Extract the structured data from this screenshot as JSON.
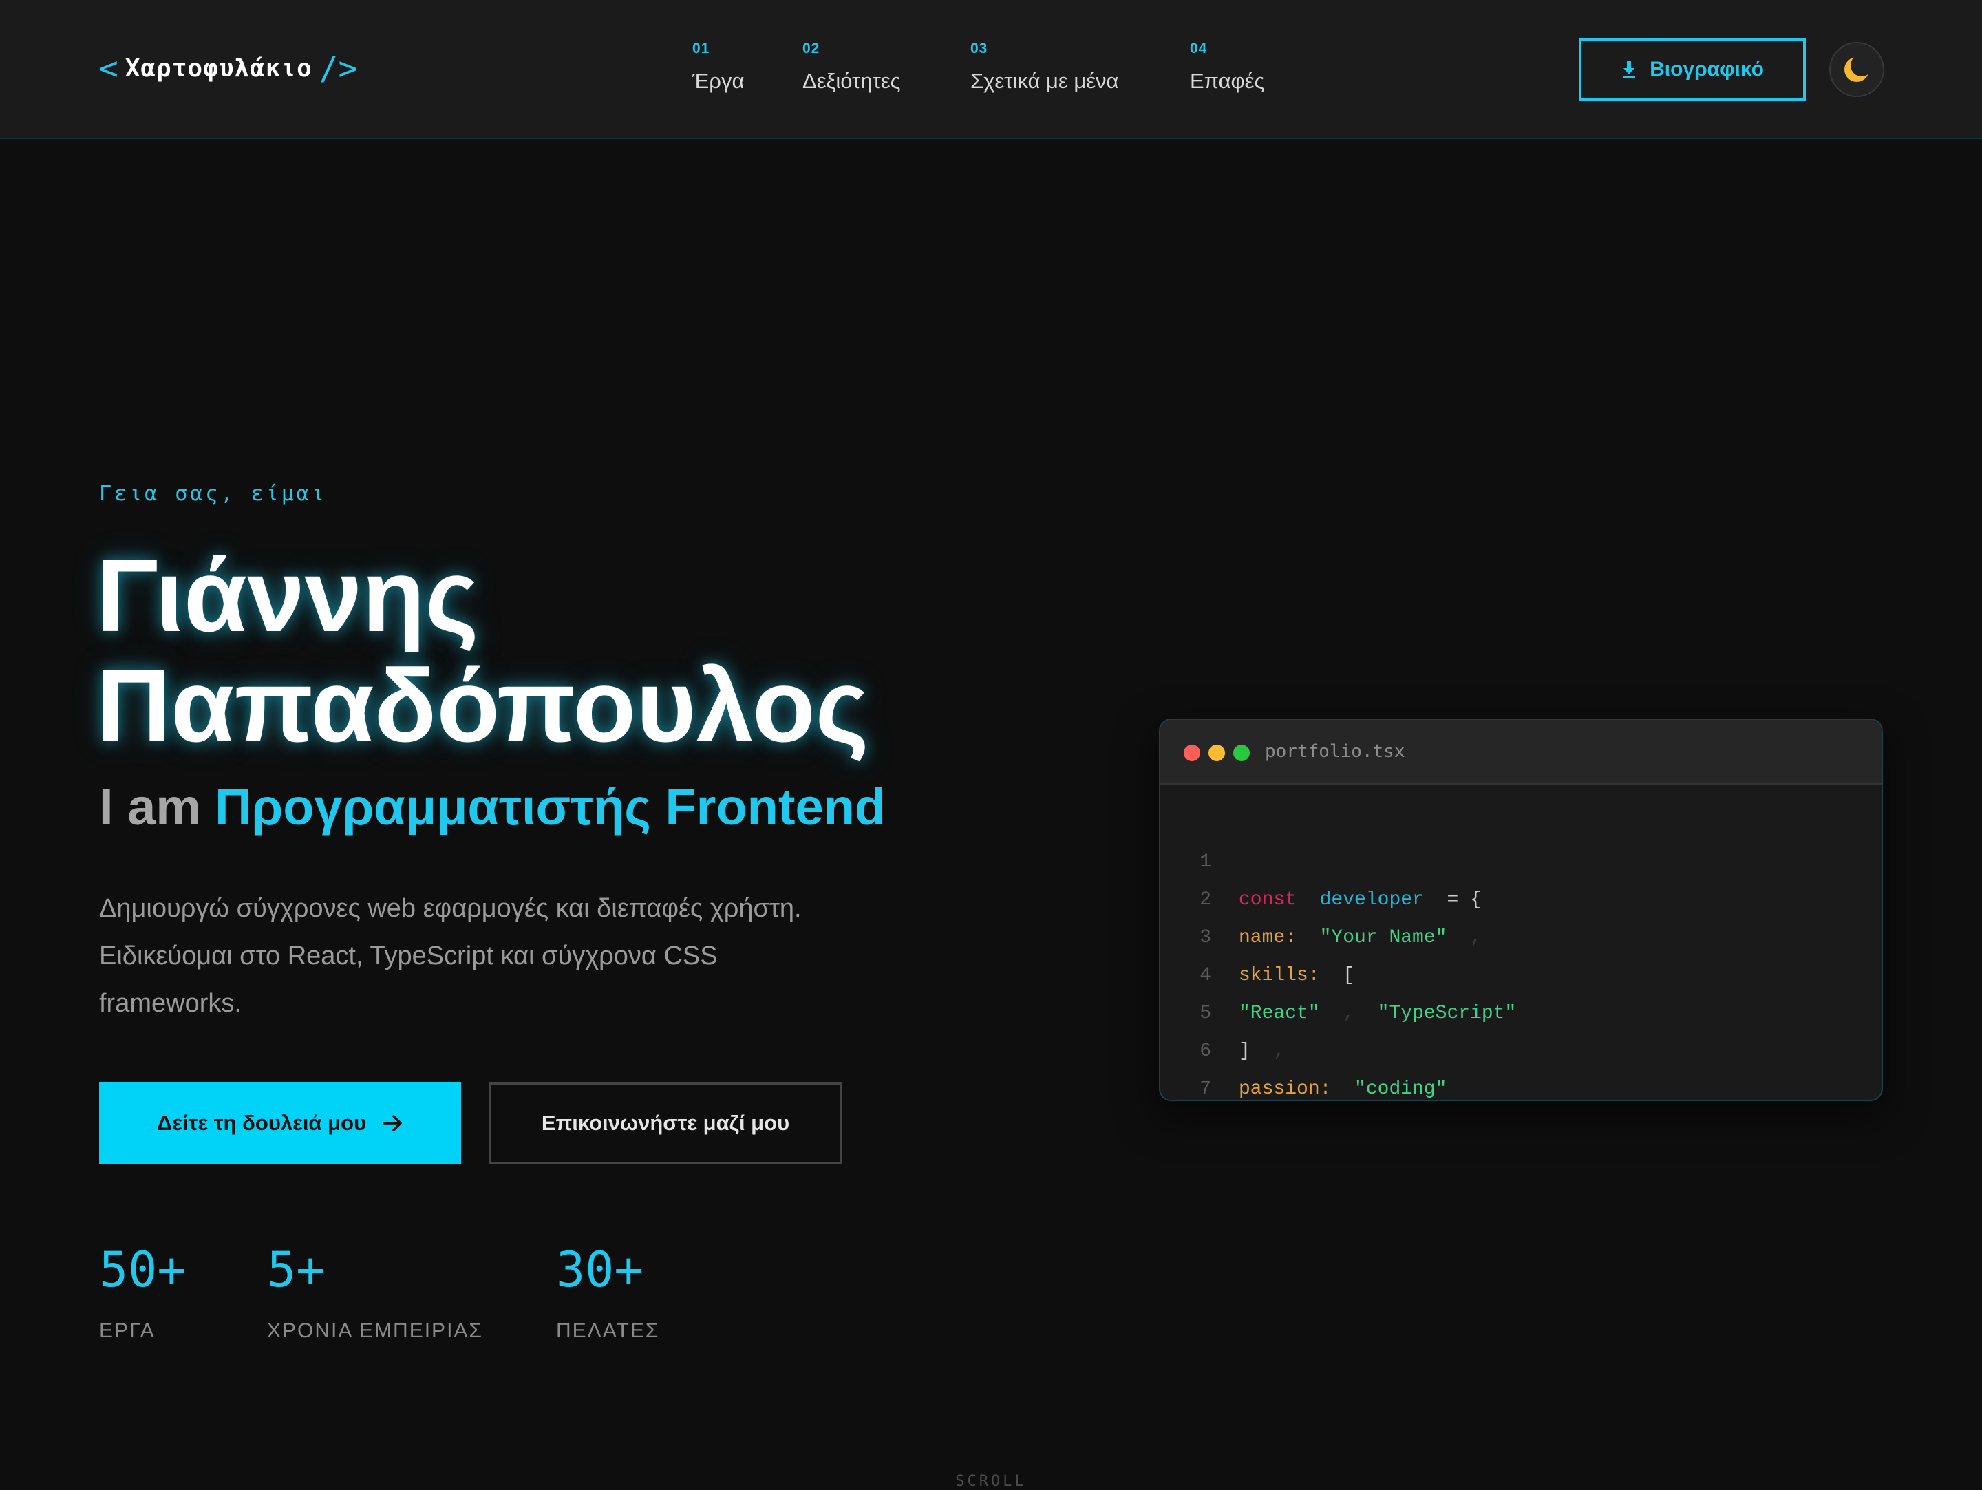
{
  "header": {
    "logo": {
      "open": "<",
      "text": "Χαρτοφυλάκιο",
      "close": "/>"
    },
    "nav": [
      {
        "num": "01",
        "label": "Έργα"
      },
      {
        "num": "02",
        "label": "Δεξιότητες"
      },
      {
        "num": "03",
        "label": "Σχετικά με μένα"
      },
      {
        "num": "04",
        "label": "Επαφές"
      }
    ],
    "cv_button": {
      "label": "Βιογραφικό",
      "icon": "download-icon"
    },
    "theme_toggle": {
      "icon": "moon-icon"
    }
  },
  "hero": {
    "greeting": "Γεια σας, είμαι",
    "name_line_1": "Γιάννης",
    "name_line_2": "Παπαδόπουλος",
    "role_prefix": "I am",
    "role_title": "Προγραμματιστής Frontend",
    "description": [
      "Δημιουργώ σύγχρονες web εφαρμογές και διεπαφές χρήστη.",
      "Ειδικεύομαι στο React, TypeScript και σύγχρονα CSS",
      "frameworks."
    ],
    "primary_button": {
      "label": "Δείτε τη δουλειά μου",
      "icon": "arrow-right-icon"
    },
    "secondary_button": {
      "label": "Επικοινωνήστε μαζί μου"
    },
    "stats": [
      {
        "value": "50+",
        "label": "ΕΡΓΑ"
      },
      {
        "value": "5+",
        "label": "ΧΡΟΝΙΑ ΕΜΠΕΙΡΙΑΣ"
      },
      {
        "value": "30+",
        "label": "ΠΕΛΑΤΕΣ"
      }
    ]
  },
  "code_window": {
    "file_name": "portfolio.tsx",
    "lines": [
      {
        "n": "1",
        "t1": "const",
        "t2": "developer",
        "t3": "= {"
      },
      {
        "n": "2",
        "t1": "name:",
        "t2": "\"Your Name\"",
        "t3": ","
      },
      {
        "n": "3",
        "t1": "skills:",
        "t2": "["
      },
      {
        "n": "4",
        "t1": "\"React\"",
        "t2": ",",
        "t3": "\"TypeScript\""
      },
      {
        "n": "5",
        "t1": "]",
        "t2": ","
      },
      {
        "n": "6",
        "t1": "passion:",
        "t2": "\"coding\""
      },
      {
        "n": "7",
        "t1": "}"
      }
    ]
  },
  "scroll_hint": "SCROLL",
  "colors": {
    "accent": "#1fc8ec",
    "primary_button": "#00d2f8",
    "background": "#0e0e0e",
    "header": "#1b1b1b",
    "keyword": "#e0245e",
    "string": "#3fd38a",
    "property": "#e6a23c"
  }
}
